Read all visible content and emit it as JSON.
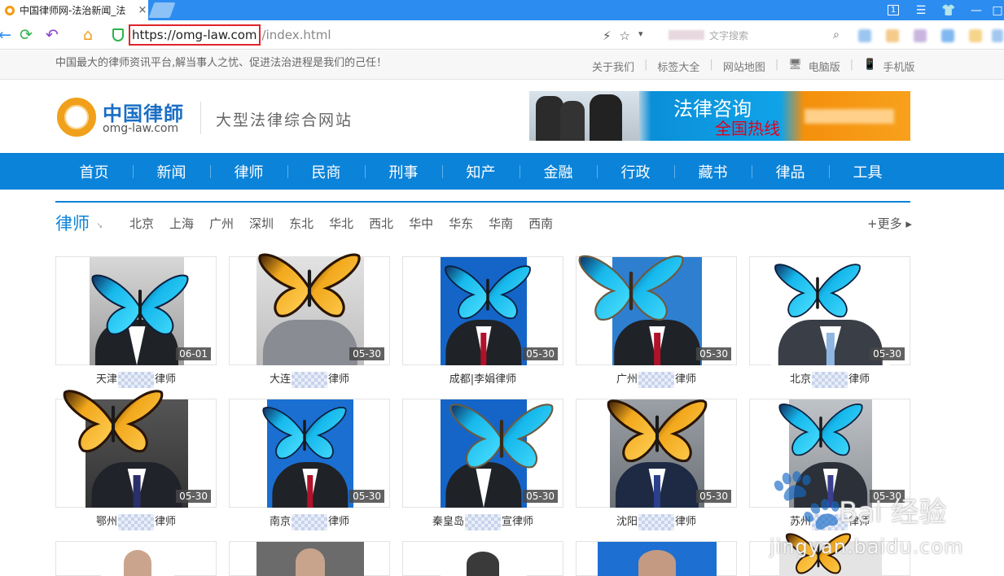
{
  "browser": {
    "tab_title": "中国律师网-法治新闻_法",
    "tab_close": "×",
    "url_highlight": "https://omg-law.com",
    "url_rest": "/index.html",
    "search_placeholder": "文字搜索",
    "window_btn_1": "1"
  },
  "site": {
    "slogan": "中国最大的律师资讯平台,解当事人之忧、促进法治进程是我们的己任！",
    "top_links": [
      "关于我们",
      "标签大全",
      "网站地图",
      "电脑版",
      "手机版"
    ],
    "logo_cn": "中国律師",
    "logo_en": "omg-law.com",
    "logo_tagline": "大型法律综合网站",
    "banner_title": "法律咨询",
    "banner_subtitle": "全国热线"
  },
  "nav": [
    "首页",
    "新闻",
    "律师",
    "民商",
    "刑事",
    "知产",
    "金融",
    "行政",
    "藏书",
    "律品",
    "工具"
  ],
  "section": {
    "title": "律师",
    "regions": [
      "北京",
      "上海",
      "广州",
      "深圳",
      "东北",
      "华北",
      "西北",
      "华中",
      "华东",
      "华南",
      "西南"
    ],
    "more": "+更多 ▸"
  },
  "lawyers": [
    {
      "date": "06-01",
      "prefix": "天津",
      "suffix": "律师"
    },
    {
      "date": "05-30",
      "prefix": "大连",
      "suffix": "律师"
    },
    {
      "date": "05-30",
      "prefix": "成都|李娟律师",
      "suffix": ""
    },
    {
      "date": "05-30",
      "prefix": "广州",
      "suffix": "律师"
    },
    {
      "date": "05-30",
      "prefix": "北京",
      "suffix": "律师"
    },
    {
      "date": "05-30",
      "prefix": "鄂州",
      "suffix": "律师"
    },
    {
      "date": "05-30",
      "prefix": "南京",
      "suffix": "律师"
    },
    {
      "date": "05-30",
      "prefix": "秦皇岛",
      "suffix": "宣律师"
    },
    {
      "date": "05-30",
      "prefix": "沈阳",
      "suffix": "律师"
    },
    {
      "date": "05-30",
      "prefix": "苏州",
      "suffix": "律师"
    }
  ],
  "watermark": {
    "brand": "Bai 经验",
    "domain": "jingyan.baidu.com"
  },
  "colors": {
    "primary": "#0b83d9",
    "browser_bar": "#2d8cf0",
    "url_highlight_border": "#e0242b",
    "butterfly_blue": "#22c4f0",
    "butterfly_orange": "#f2a81c"
  }
}
